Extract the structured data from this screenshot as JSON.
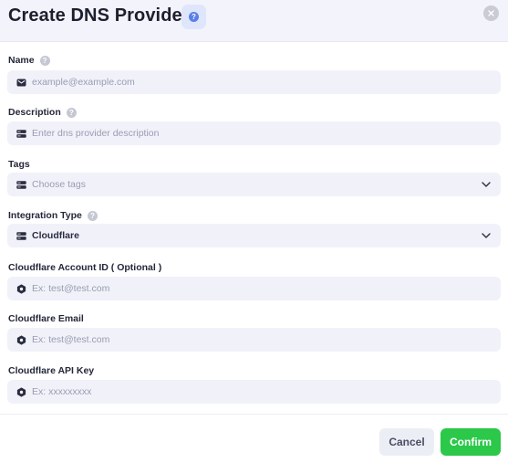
{
  "dialog": {
    "title": "Create DNS Provider",
    "help_glyph": "?",
    "close_glyph": "×"
  },
  "fields": {
    "name": {
      "label": "Name",
      "help": "?",
      "placeholder": "example@example.com"
    },
    "description": {
      "label": "Description",
      "help": "?",
      "placeholder": "Enter dns provider description"
    },
    "tags": {
      "label": "Tags",
      "placeholder": "Choose tags"
    },
    "integration_type": {
      "label": "Integration Type",
      "help": "?",
      "value": "Cloudflare"
    },
    "account_id": {
      "label": "Cloudflare Account ID ( Optional )",
      "placeholder": "Ex: test@test.com"
    },
    "email": {
      "label": "Cloudflare Email",
      "placeholder": "Ex: test@test.com"
    },
    "api_key": {
      "label": "Cloudflare API Key",
      "placeholder": "Ex: xxxxxxxxx"
    }
  },
  "footer": {
    "cancel_label": "Cancel",
    "confirm_label": "Confirm"
  },
  "icons": {
    "name_field": "envelope-icon",
    "description_field": "server-icon",
    "tags_field": "server-icon",
    "integration_field": "server-icon",
    "cloudflare_fields": "hexagon-dot-icon",
    "dropdown": "chevron-down-icon"
  },
  "colors": {
    "header_bg": "#f3f3fb",
    "input_bg": "#f1f1fa",
    "accent_help": "#5b7fe8",
    "confirm": "#2bc84a"
  }
}
